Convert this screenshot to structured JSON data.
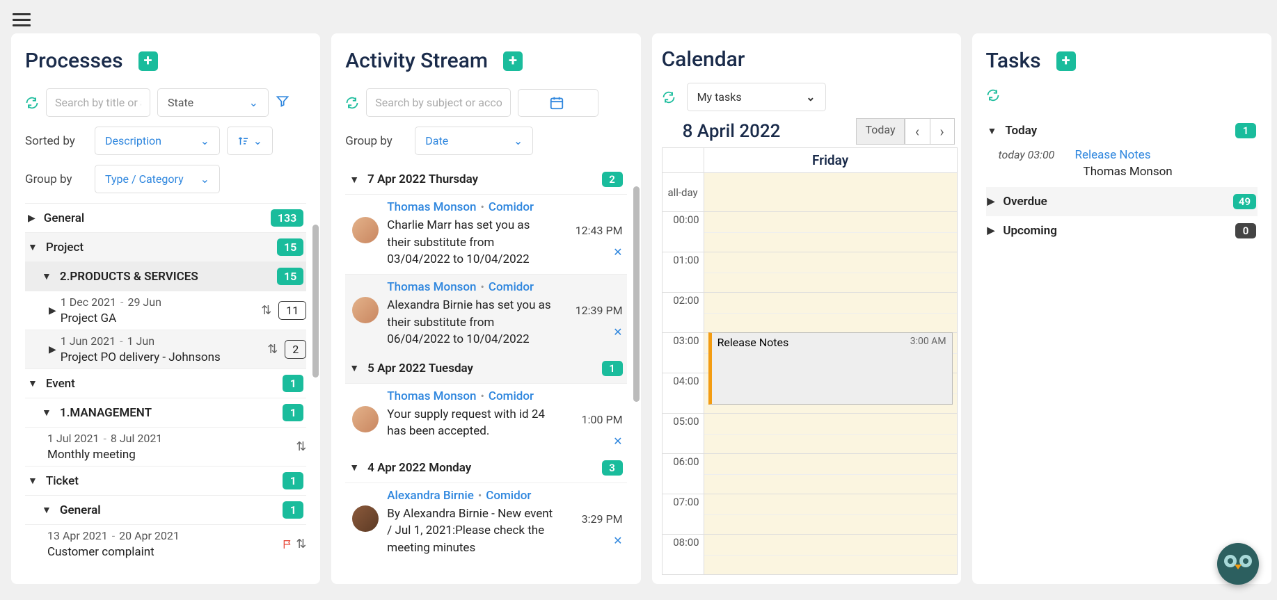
{
  "processes": {
    "title": "Processes",
    "search_placeholder": "Search by title or a",
    "state_label": "State",
    "sorted_by_label": "Sorted by",
    "sorted_by_value": "Description",
    "group_by_label": "Group by",
    "group_by_value": "Type / Category",
    "groups": [
      {
        "label": "General",
        "count": "133",
        "expanded": false
      },
      {
        "label": "Project",
        "count": "15",
        "expanded": true,
        "sub": {
          "label": "2.PRODUCTS & SERVICES",
          "count": "15",
          "items": [
            {
              "date1": "1 Dec 2021",
              "date2": "29 Jun",
              "name": "Project GA",
              "num": "11"
            },
            {
              "date1": "1 Jun 2021",
              "date2": "1 Jun",
              "name": "Project PO delivery - Johnsons",
              "num": "2"
            }
          ]
        }
      },
      {
        "label": "Event",
        "count": "1",
        "expanded": true,
        "sub": {
          "label": "1.MANAGEMENT",
          "count": "1",
          "items": [
            {
              "date1": "1 Jul 2021",
              "date2": "8 Jul 2021",
              "name": "Monthly meeting"
            }
          ]
        }
      },
      {
        "label": "Ticket",
        "count": "1",
        "expanded": true,
        "sub": {
          "label": "General",
          "count": "1",
          "items": [
            {
              "date1": "13 Apr 2021",
              "date2": "20 Apr 2021",
              "name": "Customer complaint"
            }
          ]
        }
      }
    ]
  },
  "activity": {
    "title": "Activity Stream",
    "search_placeholder": "Search by subject or accoun",
    "group_by_label": "Group by",
    "group_by_value": "Date",
    "groups": [
      {
        "header": "7 Apr 2022 Thursday",
        "count": "2",
        "items": [
          {
            "person": "Thomas Monson",
            "org": "Comidor",
            "text": "Charlie Marr has set you as their substitute from 03/04/2022 to 10/04/2022",
            "time": "12:43 PM"
          },
          {
            "person": "Thomas Monson",
            "org": "Comidor",
            "text": "Alexandra Birnie has set you as their substitute from 06/04/2022 to 10/04/2022",
            "time": "12:39 PM"
          }
        ]
      },
      {
        "header": "5 Apr 2022 Tuesday",
        "count": "1",
        "items": [
          {
            "person": "Thomas Monson",
            "org": "Comidor",
            "text": "Your supply request with id 24 has been accepted.",
            "time": "1:00 PM"
          }
        ]
      },
      {
        "header": "4 Apr 2022 Monday",
        "count": "3",
        "items": [
          {
            "person": "Alexandra Birnie",
            "org": "Comidor",
            "text": "By Alexandra Birnie - New event / Jul 1, 2021:Please check the meeting minutes",
            "time": "3:29 PM"
          }
        ]
      }
    ]
  },
  "calendar": {
    "title": "Calendar",
    "selector_label": "My tasks",
    "date_label": "8 April 2022",
    "today_label": "Today",
    "day_name": "Friday",
    "allday_label": "all-day",
    "hours": [
      "00:00",
      "01:00",
      "02:00",
      "03:00",
      "04:00",
      "05:00",
      "06:00",
      "07:00",
      "08:00"
    ],
    "event": {
      "title": "Release Notes",
      "time": "3:00 AM"
    }
  },
  "tasks": {
    "title": "Tasks",
    "sections": [
      {
        "label": "Today",
        "count": "1",
        "expanded": true,
        "items": [
          {
            "time": "today 03:00",
            "title": "Release Notes",
            "sub": "Thomas Monson"
          }
        ]
      },
      {
        "label": "Overdue",
        "count": "49",
        "expanded": false
      },
      {
        "label": "Upcoming",
        "count": "0",
        "expanded": false
      }
    ]
  }
}
